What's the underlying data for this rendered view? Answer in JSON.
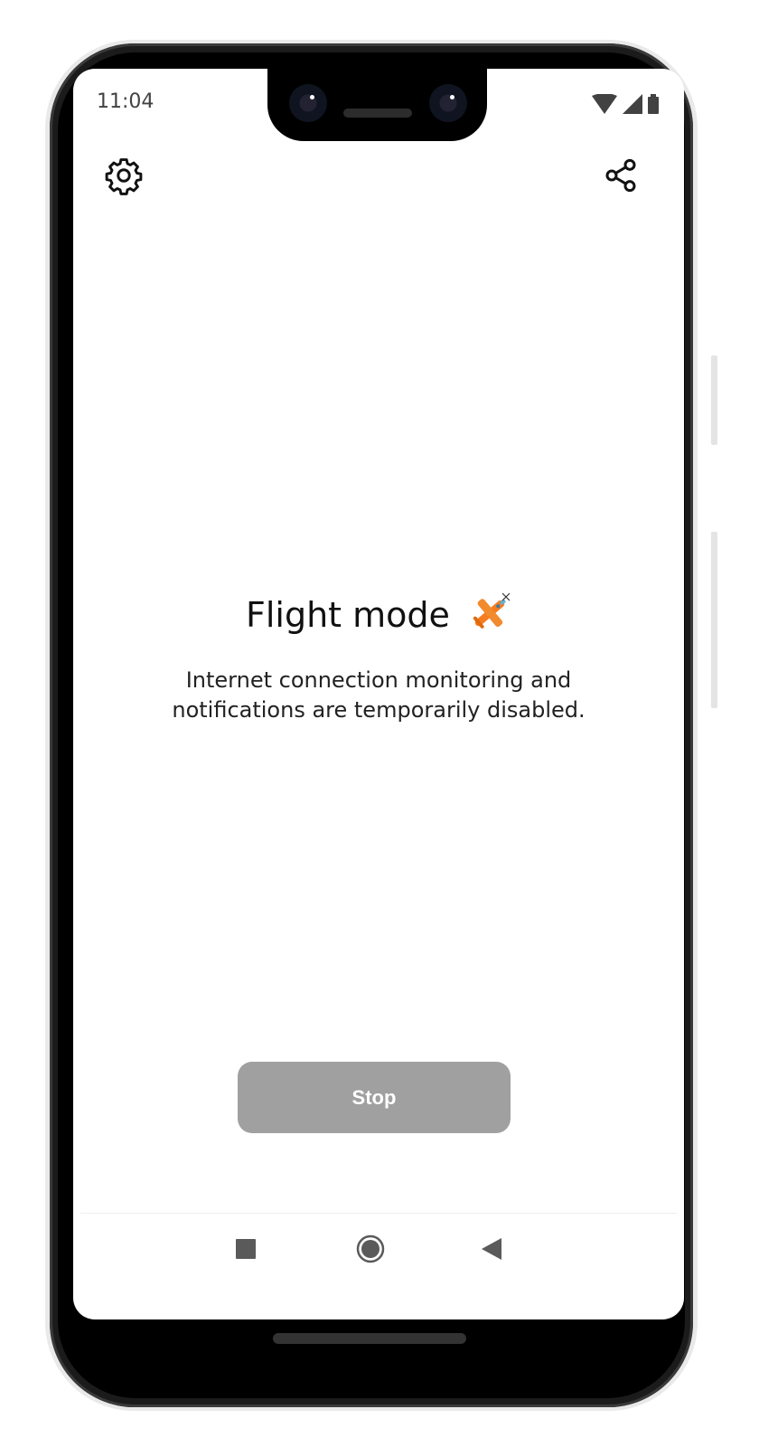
{
  "status_bar": {
    "time": "11:04",
    "icons": [
      "wifi-icon",
      "signal-icon",
      "battery-icon"
    ]
  },
  "toolbar": {
    "settings_icon": "gear-icon",
    "share_icon": "share-icon"
  },
  "content": {
    "title": "Flight mode",
    "title_emoji": "airplane-icon",
    "description_line1": "Internet connection monitoring and",
    "description_line2": "notifications are temporarily disabled."
  },
  "actions": {
    "stop_label": "Stop",
    "stop_color": "#a0a0a0"
  },
  "nav_bar": {
    "items": [
      "recents-icon",
      "home-icon",
      "back-icon"
    ]
  }
}
